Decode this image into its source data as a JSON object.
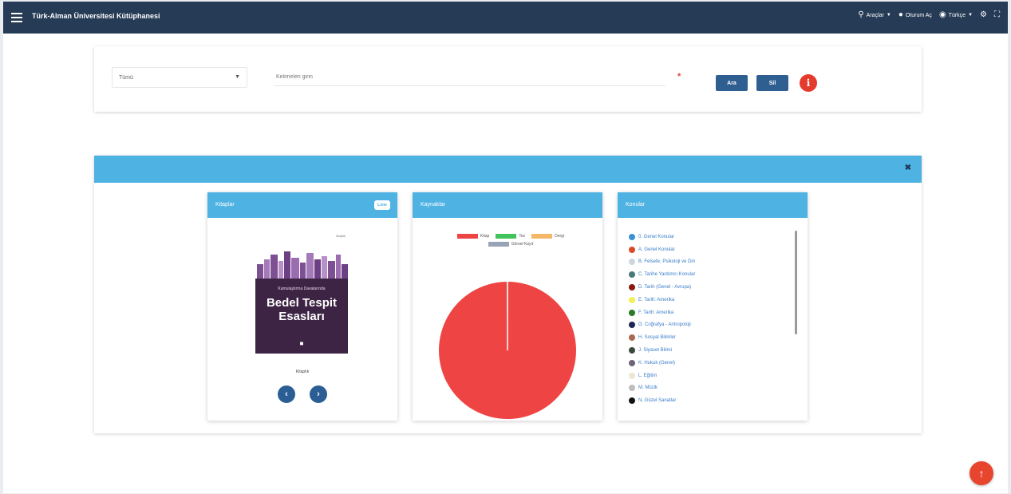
{
  "header": {
    "brand": "Türk-Alman Üniversitesi Kütüphanesi",
    "nav": [
      {
        "icon": "search-icon",
        "label": "Araçlar"
      },
      {
        "icon": "user-icon",
        "label": "Oturum Aç"
      },
      {
        "icon": "globe-icon",
        "label": "Türkçe"
      }
    ]
  },
  "search": {
    "select_value": "Tümü",
    "input_placeholder": "Kelimeleri girin",
    "required_mark": "*",
    "search_button": "Ara",
    "clear_button": "Sil",
    "info_icon": "i"
  },
  "cards": {
    "books": {
      "title": "Kitaplar",
      "toggle": "Liste",
      "cover": {
        "publisher": "Seçkin",
        "subtitle": "Kamulaştırma Davalarında",
        "title_line1": "Bedel Tespit",
        "title_line2": "Esasları"
      },
      "label": "Kitaplık"
    },
    "sources": {
      "title": "Kaynaklar",
      "legend": [
        {
          "label": "Kitap",
          "color": "#ef4444"
        },
        {
          "label": "Tez",
          "color": "#43c35e"
        },
        {
          "label": "Dergi",
          "color": "#f5b868"
        },
        {
          "label": "Görsel Kayıt",
          "color": "#99a3b6"
        }
      ]
    },
    "subjects": {
      "title": "Konular",
      "items": [
        {
          "label": "0. Genel Konular",
          "color": "#3b8fd6"
        },
        {
          "label": "A. Genel Konular",
          "color": "#d94a2b"
        },
        {
          "label": "B. Felsefe, Psikoloji ve Din",
          "color": "#cfd6e2"
        },
        {
          "label": "C. Tarihe Yardımcı Konular",
          "color": "#4a7a78"
        },
        {
          "label": "D. Tarih (Genel - Avrupa)",
          "color": "#8a1a10"
        },
        {
          "label": "E. Tarih: Amerika",
          "color": "#f2ef5a"
        },
        {
          "label": "F. Tarih: Amerika",
          "color": "#2b7a24"
        },
        {
          "label": "G. Coğrafya - Antropoloji",
          "color": "#1b2855"
        },
        {
          "label": "H. Sosyal Bilimler",
          "color": "#a86b52"
        },
        {
          "label": "J. Siyaset Bilimi",
          "color": "#3a4a3a"
        },
        {
          "label": "K. Hukuk (Genel)",
          "color": "#6a6578"
        },
        {
          "label": "L. Eğitim",
          "color": "#ece7d2"
        },
        {
          "label": "M. Müzik",
          "color": "#bdbdbd"
        },
        {
          "label": "N. Güzel Sanatlar",
          "color": "#111111"
        }
      ]
    }
  },
  "chart_data": {
    "type": "pie",
    "categories": [
      "Kitap",
      "Tez",
      "Dergi",
      "Görsel Kayıt"
    ],
    "values": [
      99.8,
      0.1,
      0.05,
      0.05
    ],
    "colors": [
      "#ef4444",
      "#43c35e",
      "#f5b868",
      "#99a3b6"
    ]
  }
}
